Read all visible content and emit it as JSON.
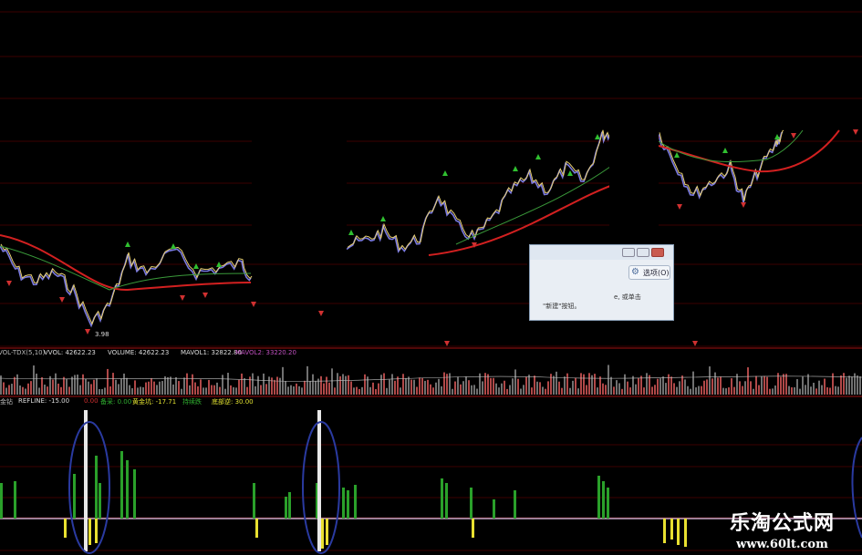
{
  "top_title": "",
  "volume_header": {
    "indicator": "VOL-TDX(5,10)",
    "vvol": "VVOL: 42622.23",
    "volume": "VOLUME: 42622.23",
    "mavol1": "MAVOL1: 32822.80",
    "mavol2": "MAVOL2: 33220.20"
  },
  "indicator_header": {
    "name": "金钻",
    "refline": "REFLINE: -15.00",
    "val1": "0.00",
    "label2": "备采: 0.00",
    "label3": "黄金坑: -17.71",
    "label4": "持续跌",
    "label5": "底部逆: 30.00"
  },
  "dialog": {
    "options_label": "选项(O)",
    "line1": "e, 或单击",
    "line2": "\"新建\"按钮。"
  },
  "watermark": {
    "title": "乐淘公式网",
    "url": "www.60lt.com"
  },
  "price_label": "3.98",
  "colors": {
    "background": "#000000",
    "grid_red": "#7a0000",
    "ma_long": "#d22020",
    "ma_mid": "#3a9a3a",
    "candles_a": "#e8d070",
    "candles_b": "#7a7ae0",
    "signal_green": "#2aa02a",
    "signal_yellow": "#e8e030",
    "volume_bars": "#b04848",
    "circle_marks": "#2a3aa0"
  }
}
